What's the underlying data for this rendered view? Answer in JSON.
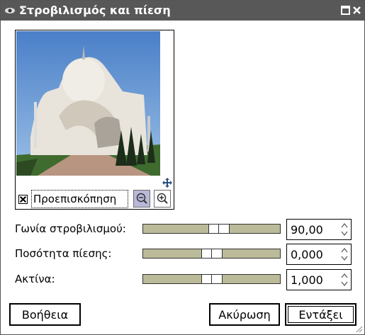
{
  "window": {
    "title": "Στροβιλισμός και πίεση",
    "titlebar_color": "#585858"
  },
  "preview": {
    "checkbox_checked": true,
    "label": "Προεπισκόπηση"
  },
  "params": [
    {
      "label": "Γωνία στροβιλισμού:",
      "value": "90,00",
      "slider_position": 0.55
    },
    {
      "label": "Ποσότητα πίεσης:",
      "value": "0,000",
      "slider_position": 0.5
    },
    {
      "label": "Ακτίνα:",
      "value": "1,000",
      "slider_position": 0.5
    }
  ],
  "buttons": {
    "help": "Βοήθεια",
    "cancel": "Ακύρωση",
    "ok": "Εντάξει"
  },
  "colors": {
    "slider_trough": "#bbbb99",
    "zoom_active": "#b8b8d8"
  }
}
